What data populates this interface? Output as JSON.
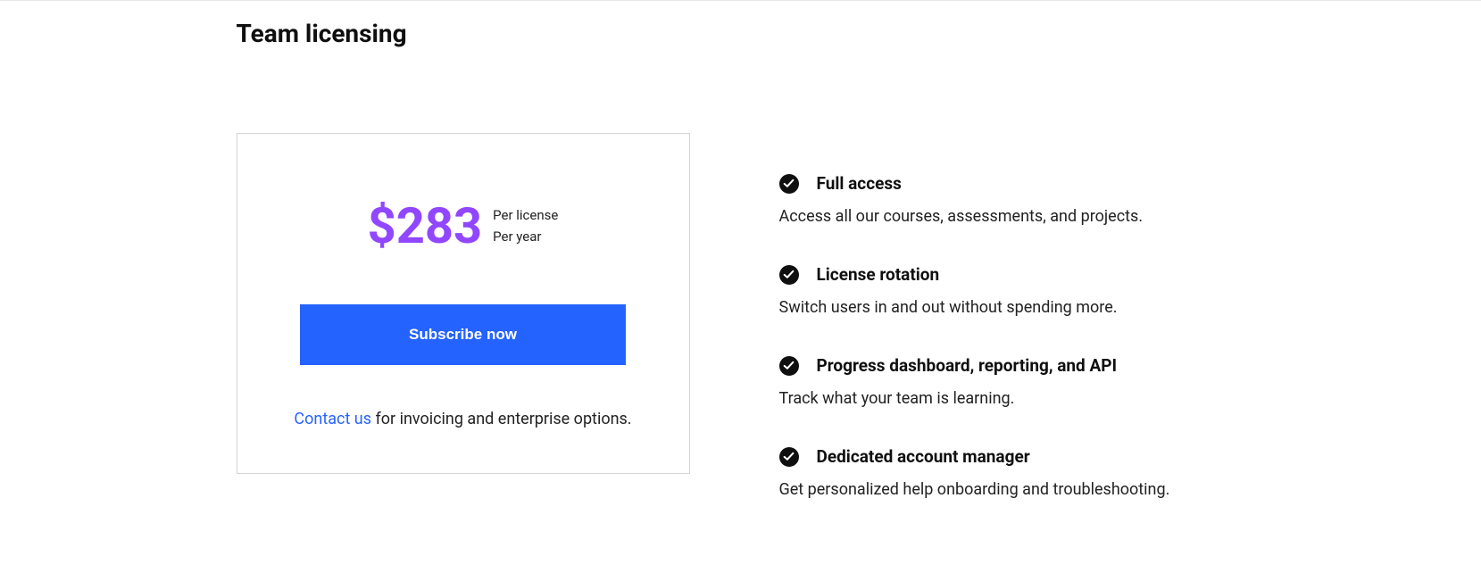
{
  "title": "Team licensing",
  "pricing": {
    "price": "$283",
    "per_license": "Per license",
    "per_year": "Per year",
    "subscribe_label": "Subscribe now",
    "contact_link": "Contact us",
    "contact_text": " for invoicing and enterprise options."
  },
  "features": [
    {
      "title": "Full access",
      "description": "Access all our courses, assessments, and projects."
    },
    {
      "title": "License rotation",
      "description": "Switch users in and out without spending more."
    },
    {
      "title": "Progress dashboard, reporting, and API",
      "description": "Track what your team is learning."
    },
    {
      "title": "Dedicated account manager",
      "description": "Get personalized help onboarding and troubleshooting."
    }
  ]
}
